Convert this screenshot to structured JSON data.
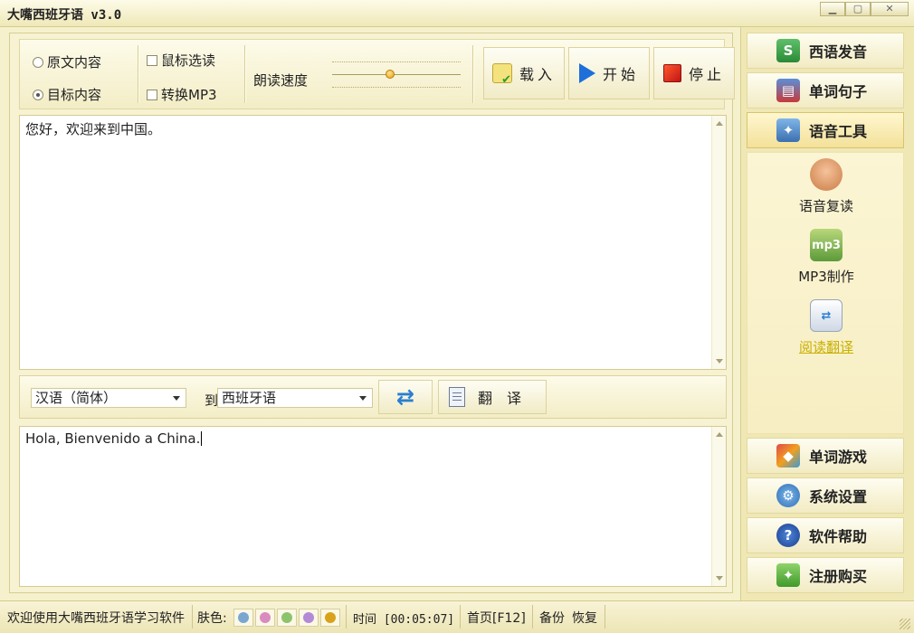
{
  "window": {
    "title": "大嘴西班牙语 v3.0"
  },
  "toolbar": {
    "source_option": "原文内容",
    "target_option": "目标内容",
    "mouse_read": "鼠标选读",
    "convert_mp3": "转换MP3",
    "speed_label": "朗读速度",
    "speed_level": 0.45,
    "load_label": "载入",
    "start_label": "开始",
    "stop_label": "停止"
  },
  "source_text": "您好，欢迎来到中国。",
  "translate": {
    "from_lang": "汉语（简体）",
    "to_label": "到",
    "to_lang": "西班牙语",
    "translate_label": "翻译"
  },
  "target_text": "Hola, Bienvenido a China.",
  "nav": {
    "pronunciation": "西语发音",
    "sentences": "单词句子",
    "voice_tools": "语音工具",
    "games": "单词游戏",
    "settings": "系统设置",
    "help": "软件帮助",
    "register": "注册购买"
  },
  "subtools": {
    "repeat": "语音复读",
    "mp3": "MP3制作",
    "reading": "阅读翻译"
  },
  "status": {
    "welcome": "欢迎使用大嘴西班牙语学习软件",
    "skin_label": "肤色:",
    "skin_colors": [
      "#7aa7cf",
      "#d98bc0",
      "#8cc46e",
      "#b38ad6",
      "#d9a21b"
    ],
    "time": "时间 [00:05:07]",
    "home": "首页[F12]",
    "backup": "备份",
    "restore": "恢复"
  }
}
